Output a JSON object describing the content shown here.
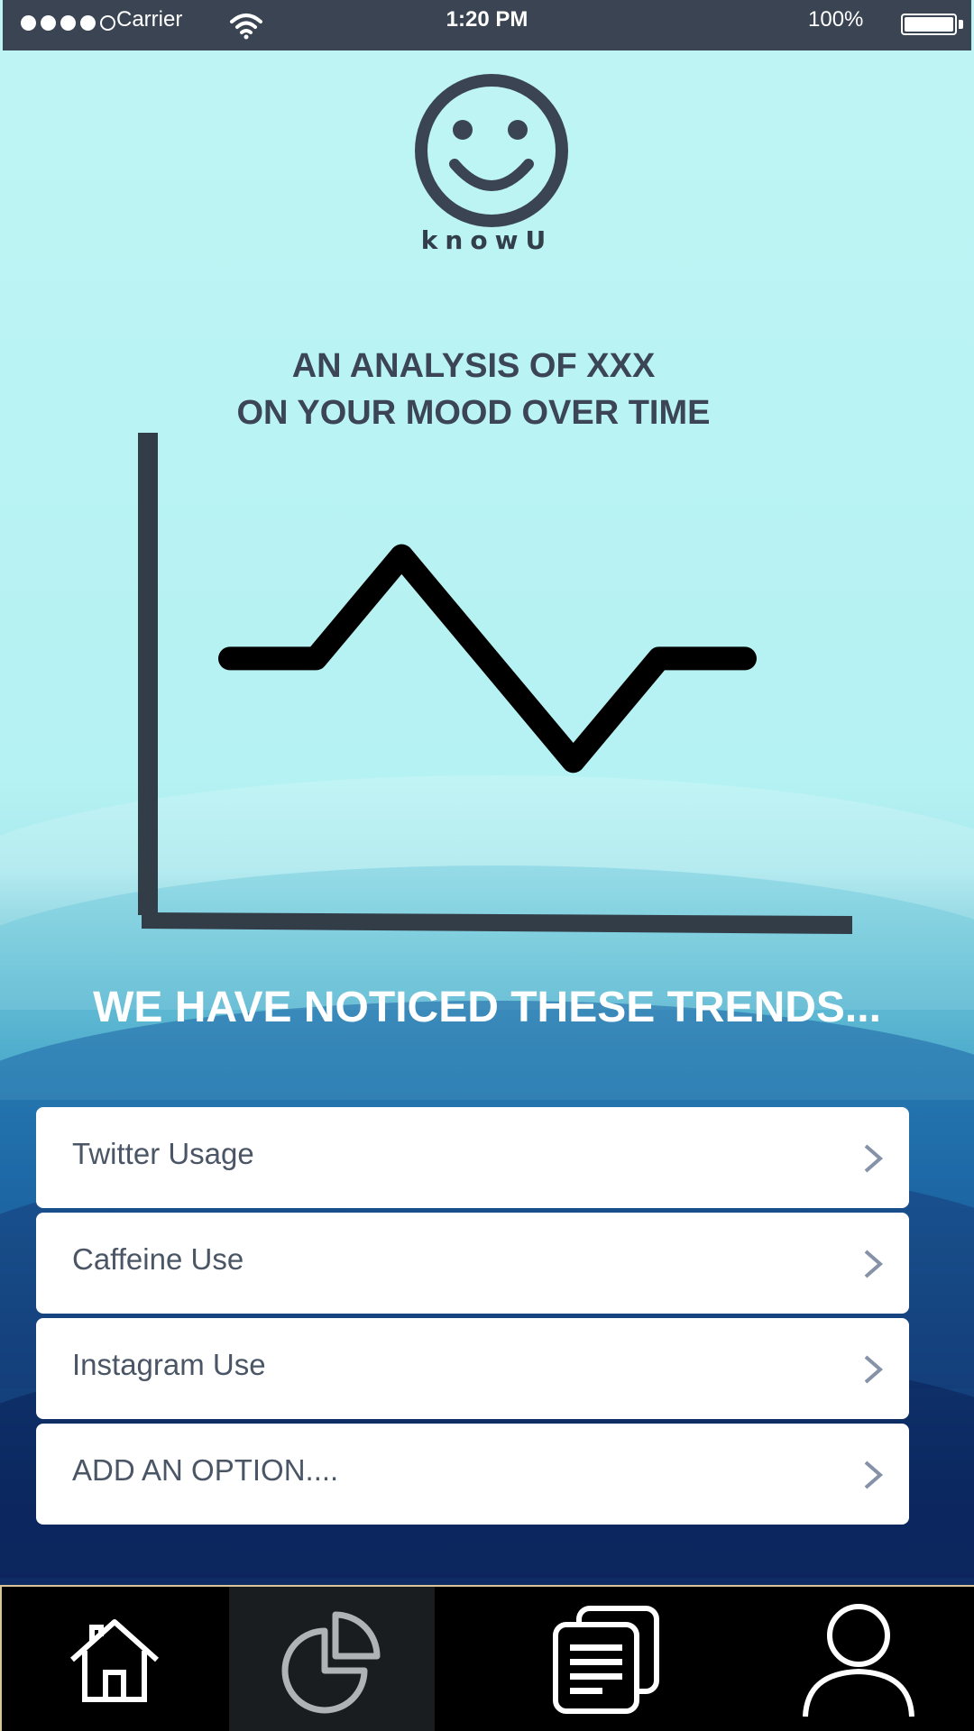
{
  "status_bar": {
    "carrier": "Carrier",
    "time": "1:20 PM",
    "battery": "100%",
    "signal_icon": "signal-dots-icon",
    "wifi_icon": "wifi-icon",
    "battery_icon": "battery-icon"
  },
  "app": {
    "logo_icon": "smiley-face-icon",
    "logo_text": "knowU"
  },
  "chart": {
    "title_line1": "AN ANALYSIS OF XXX",
    "title_line2": "ON YOUR MOOD OVER TIME"
  },
  "chart_data": {
    "type": "line",
    "title": "AN ANALYSIS OF XXX ON YOUR MOOD OVER TIME",
    "xlabel": "",
    "ylabel": "",
    "grid": false,
    "x": [
      0,
      1,
      2,
      3,
      4,
      5,
      6
    ],
    "series": [
      {
        "values": [
          0,
          0,
          1,
          0,
          -1,
          0,
          0
        ]
      }
    ],
    "ylim": [
      -2.5,
      2.2
    ]
  },
  "trends": {
    "heading": "WE HAVE NOTICED THESE TRENDS...",
    "items": [
      {
        "label": "Twitter Usage"
      },
      {
        "label": "Caffeine Use"
      },
      {
        "label": "Instagram Use"
      },
      {
        "label": "ADD AN OPTION...."
      }
    ],
    "chevron_icon": "chevron-right-icon"
  },
  "tab_bar": {
    "tabs": [
      {
        "icon": "home-icon",
        "active": false
      },
      {
        "icon": "pie-chart-icon",
        "active": true
      },
      {
        "icon": "documents-icon",
        "active": false
      },
      {
        "icon": "user-profile-icon",
        "active": false
      }
    ]
  },
  "colors": {
    "status_bar": "#3a4452",
    "text_dark": "#3b4556",
    "tab_bar": "#000000",
    "tab_active": "#1a1d20",
    "chevron": "#8592a8"
  }
}
